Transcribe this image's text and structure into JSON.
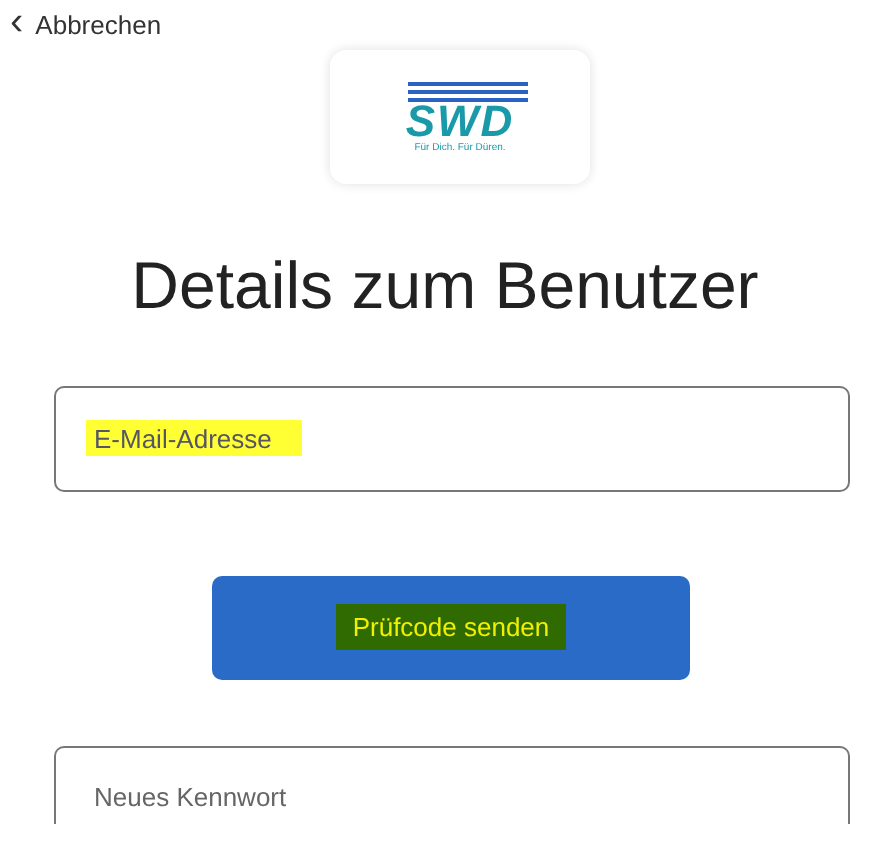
{
  "back_link": {
    "icon": "‹",
    "label": "Abbrechen"
  },
  "logo": {
    "text": "SWD",
    "tagline": "Für Dich. Für Düren."
  },
  "heading": "Details zum Benutzer",
  "email_field": {
    "placeholder": "E-Mail-Adresse",
    "highlighted": true
  },
  "send_button": {
    "label": "Prüfcode senden",
    "highlighted": true
  },
  "password_field": {
    "placeholder": "Neues Kennwort",
    "highlighted": false
  }
}
